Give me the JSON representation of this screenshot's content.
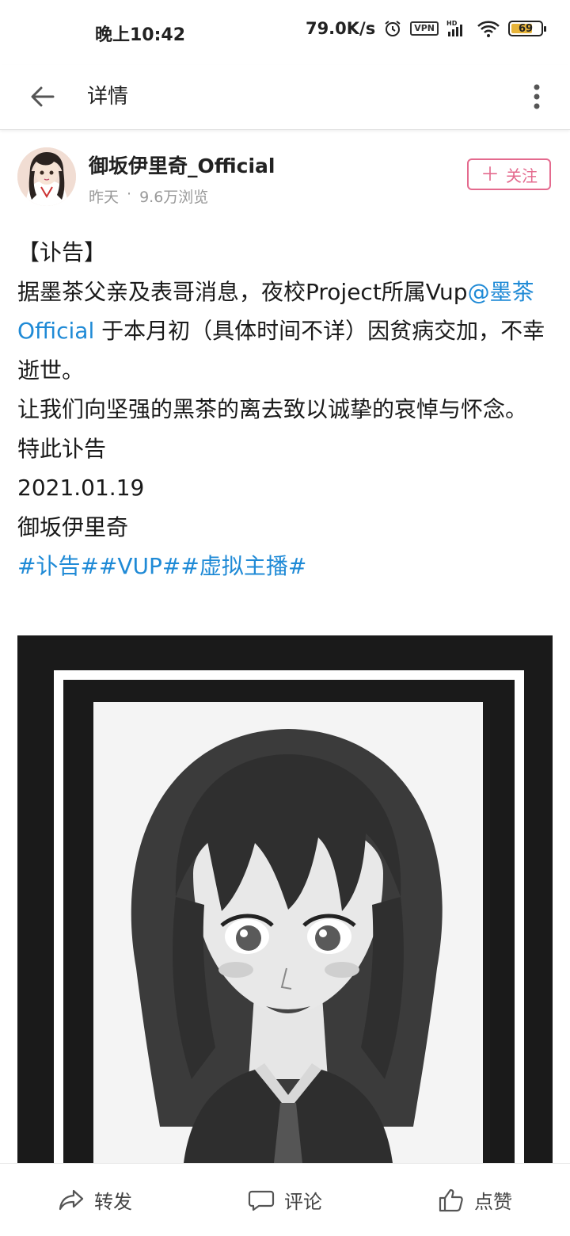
{
  "status_bar": {
    "time": "晚上10:42",
    "net_speed": "79.0K/s",
    "vpn_label": "VPN",
    "hd_label": "HD",
    "battery_level": "69"
  },
  "header": {
    "title": "详情"
  },
  "author": {
    "name": "御坂伊里奇_Official",
    "time": "昨天",
    "separator": "·",
    "views": "9.6万浏览",
    "follow_label": "关注",
    "follow_plus": "＋"
  },
  "post": {
    "line1": "【讣告】",
    "line2_prefix": "据墨茶父亲及表哥消息，夜校Project所属Vup",
    "mention": "@墨茶Official",
    "line2_suffix": " 于本月初（具体时间不详）因贫病交加，不幸逝世。",
    "line3": "让我们向坚强的黑茶的离去致以诚挚的哀悼与怀念。",
    "line4": "特此讣告",
    "line5": "2021.01.19",
    "line6": "御坂伊里奇",
    "hashtags": "#讣告##VUP##虚拟主播#"
  },
  "actions": {
    "share_label": "转发",
    "comment_label": "评论",
    "like_label": "点赞"
  },
  "icons": {
    "back": "arrow-left-icon",
    "more": "more-vertical-icon",
    "share": "share-arrow-icon",
    "comment": "comment-bubble-icon",
    "like": "thumbs-up-icon"
  },
  "colors": {
    "accent_pink": "#e46a8e",
    "link_blue": "#1f8ad6",
    "battery_yellow": "#e7b43a"
  }
}
